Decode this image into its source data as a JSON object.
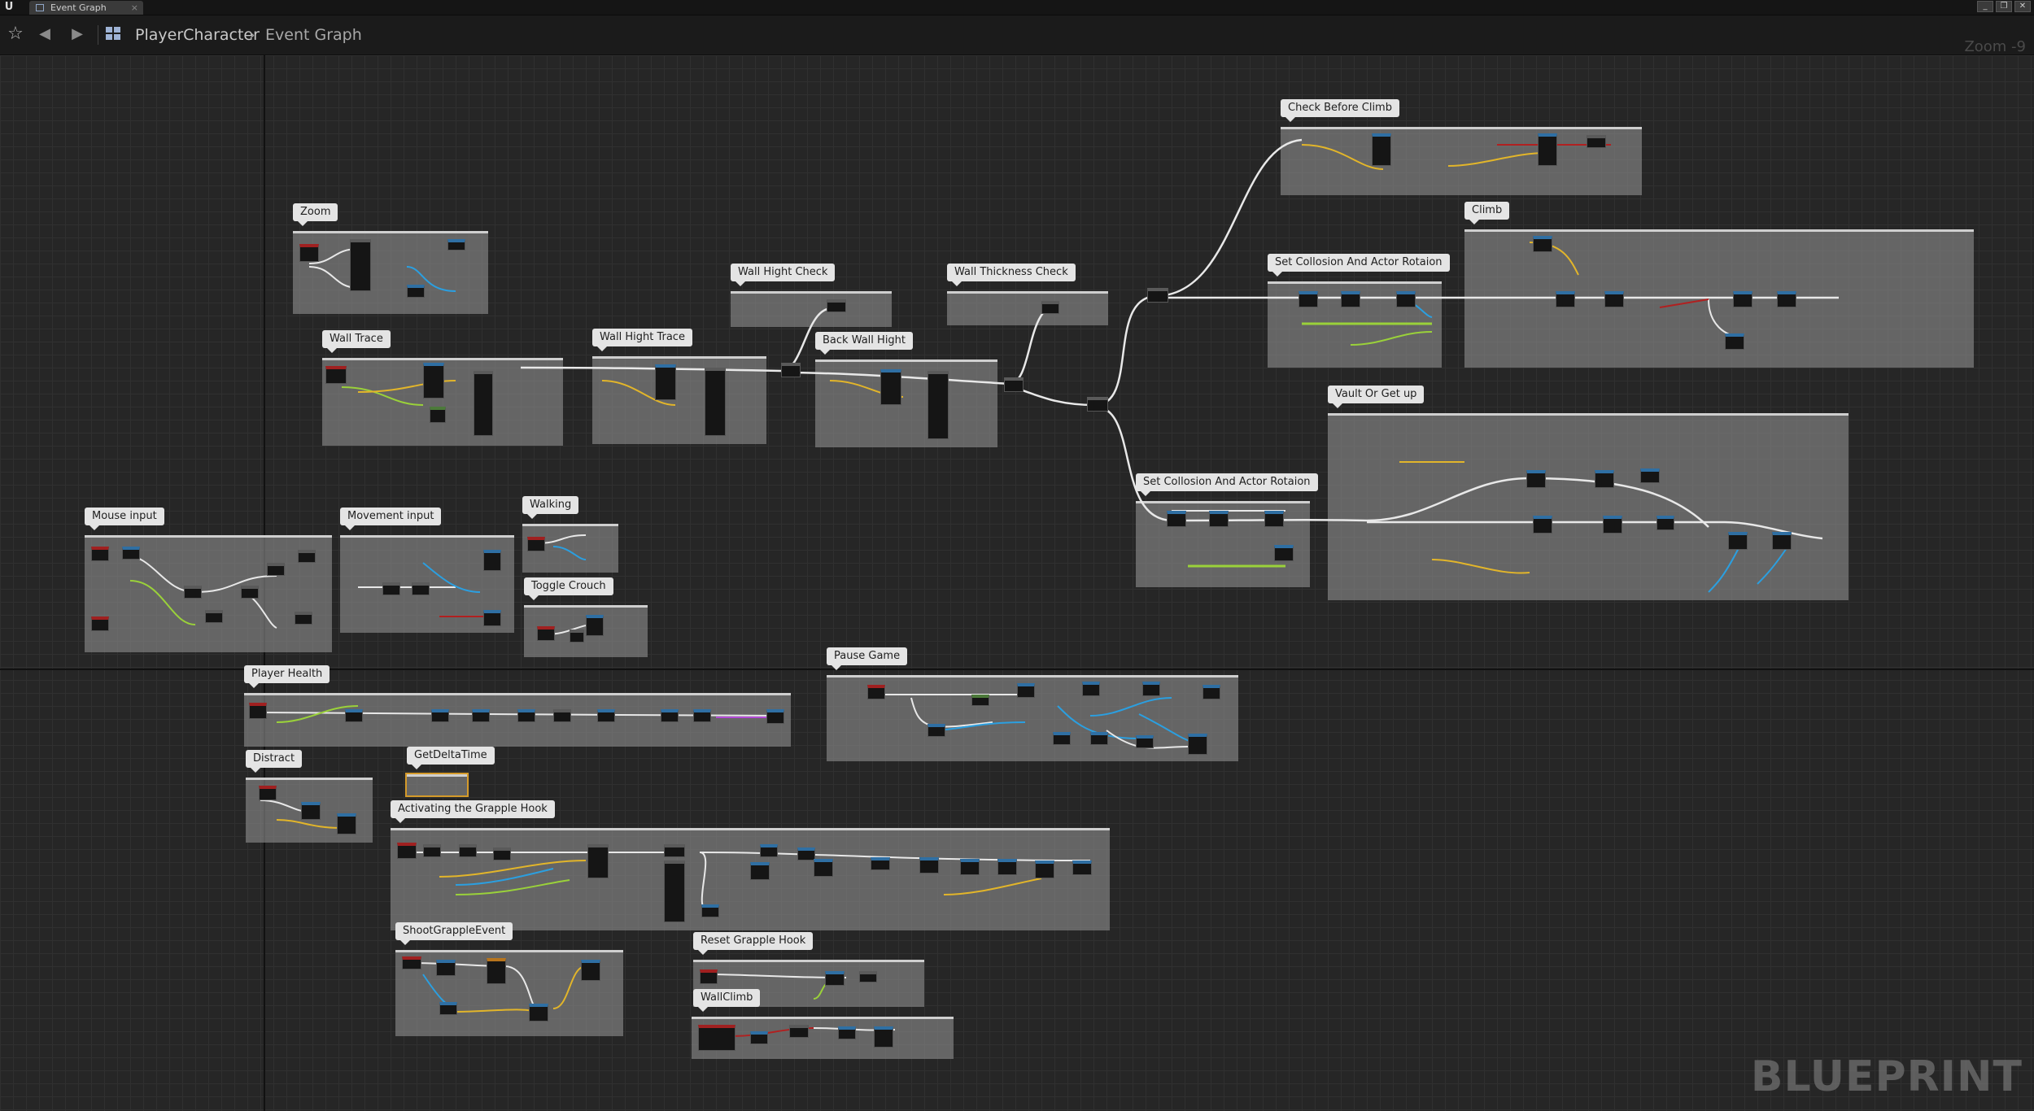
{
  "window": {
    "tab_label": "Event Graph",
    "tab_close": "×",
    "logo": "U",
    "buttons": [
      "_",
      "❐",
      "✕"
    ]
  },
  "toolbar": {
    "breadcrumb_root": "PlayerCharacter",
    "breadcrumb_separator": "›",
    "breadcrumb_current": "Event Graph",
    "zoom_label": "Zoom -9",
    "icons": [
      "star-icon",
      "back-arrow-icon",
      "forward-arrow-icon",
      "graph-icon"
    ]
  },
  "watermark": "BLUEPRINT",
  "comments": [
    {
      "key": "zoom",
      "title": "Zoom"
    },
    {
      "key": "wall-trace",
      "title": "Wall Trace"
    },
    {
      "key": "wall-hight-check",
      "title": "Wall Hight Check"
    },
    {
      "key": "wall-hight-trace",
      "title": "Wall Hight Trace"
    },
    {
      "key": "wall-thickness-check",
      "title": "Wall Thickness Check"
    },
    {
      "key": "back-wall-hight",
      "title": "Back Wall Hight"
    },
    {
      "key": "check-before-climb",
      "title": "Check Before Climb"
    },
    {
      "key": "climb",
      "title": "Climb"
    },
    {
      "key": "set-collision-top",
      "title": "Set Collosion And Actor Rotaion"
    },
    {
      "key": "vault-or-get-up",
      "title": "Vault Or Get up"
    },
    {
      "key": "set-collision-bottom",
      "title": "Set Collosion And Actor Rotaion"
    },
    {
      "key": "mouse-input",
      "title": "Mouse input"
    },
    {
      "key": "movement-input",
      "title": "Movement input"
    },
    {
      "key": "walking",
      "title": "Walking"
    },
    {
      "key": "toggle-crouch",
      "title": "Toggle Crouch"
    },
    {
      "key": "player-health",
      "title": "Player Health"
    },
    {
      "key": "pause-game",
      "title": "Pause Game"
    },
    {
      "key": "distract",
      "title": "Distract"
    },
    {
      "key": "get-delta-time",
      "title": "GetDeltaTime"
    },
    {
      "key": "activating-grapple-hook",
      "title": "Activating the Grapple Hook"
    },
    {
      "key": "shoot-grapple-event",
      "title": "ShootGrappleEvent"
    },
    {
      "key": "reset-grapple-hook",
      "title": "Reset Grapple Hook"
    },
    {
      "key": "wall-climb",
      "title": "WallClimb"
    }
  ],
  "colors": {
    "exec_wire": "#e8e8e8",
    "float_wire": "#9ad13a",
    "object_wire": "#2b9fe0",
    "struct_wire": "#e2b52a",
    "bool_wire": "#b12020",
    "comment_bg": "#8c8c8c"
  }
}
